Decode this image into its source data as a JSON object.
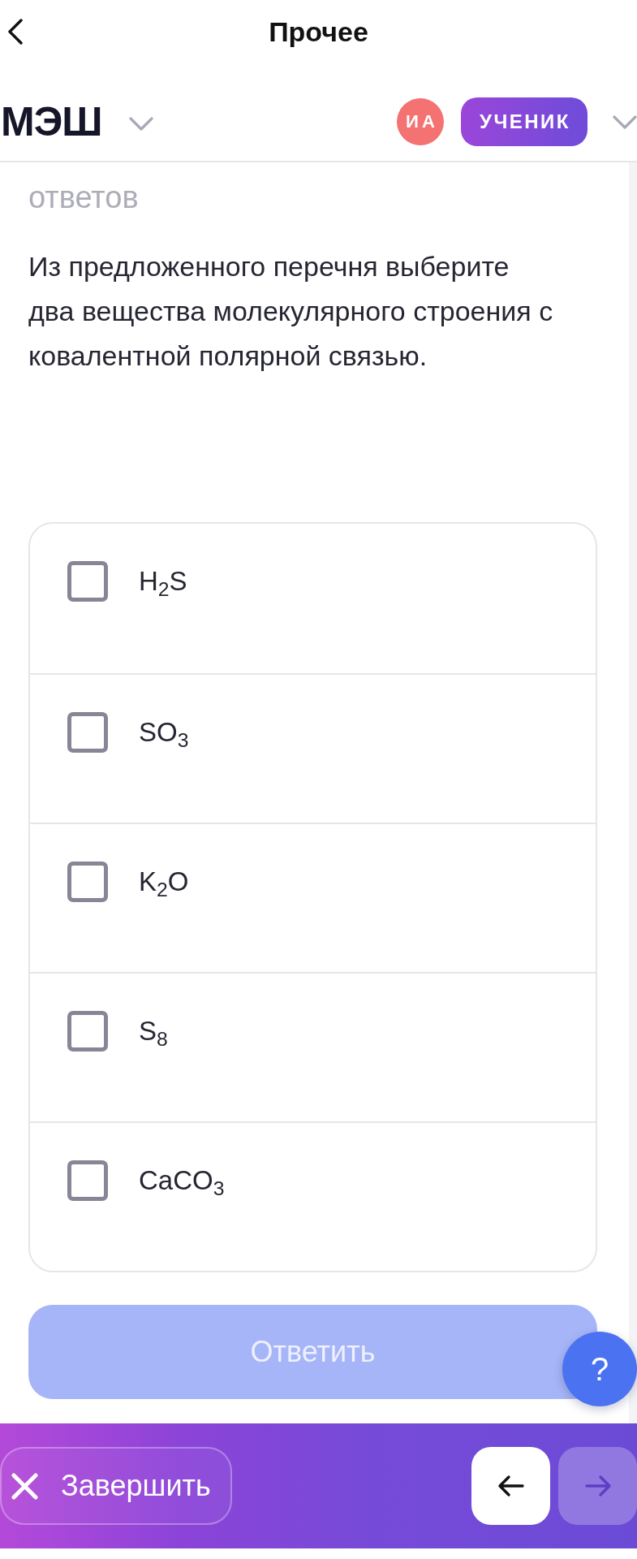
{
  "nav": {
    "title": "Прочее"
  },
  "header": {
    "logo": "МЭШ",
    "avatar_initials": "ИА",
    "role": "УЧЕНИК"
  },
  "question": {
    "hint": "ответов",
    "text": "Из предложенного перечня выберите два вещества молекулярного строения с ковалентной полярной связью.",
    "options": [
      {
        "label": "H$_{2}$S",
        "checked": false
      },
      {
        "label": "SO$_{3}$",
        "checked": false
      },
      {
        "label": "K$_{2}$O",
        "checked": false
      },
      {
        "label": "S$_{8}$",
        "checked": false
      },
      {
        "label": "CaCO$_{3}$",
        "checked": false
      }
    ],
    "answer_button": {
      "label": "Ответить",
      "disabled": true
    }
  },
  "help_button": {
    "label": "?"
  },
  "footer": {
    "finish_button": {
      "label": "Завершить"
    },
    "prev_button": {
      "disabled": false
    },
    "next_button": {
      "disabled": true
    }
  }
}
